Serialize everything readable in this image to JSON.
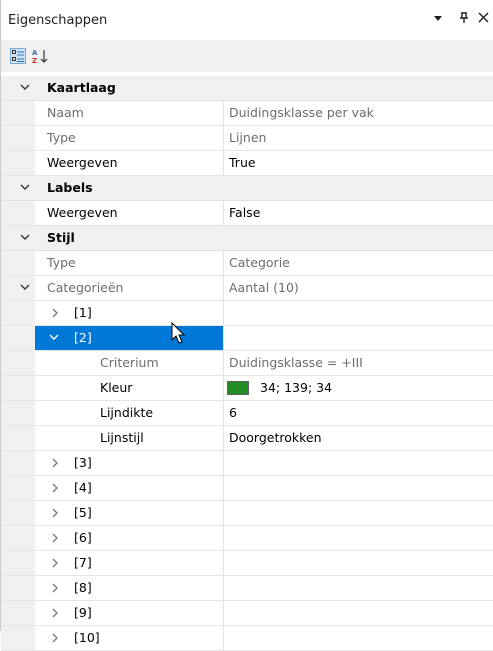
{
  "panel": {
    "title": "Eigenschappen",
    "pin_glyph": "▾",
    "dock_glyph": "ᵽ",
    "close_glyph": "✕"
  },
  "toolbar": {
    "categorized_icon": "categorized-icon",
    "alphabetical_icon": "alphabetical-sort-icon"
  },
  "sections": {
    "kaartlaag": {
      "label": "Kaartlaag",
      "naam_label": "Naam",
      "naam_value": "Duidingsklasse per vak",
      "type_label": "Type",
      "type_value": "Lijnen",
      "weergeven_label": "Weergeven",
      "weergeven_value": "True"
    },
    "labels": {
      "label": "Labels",
      "weergeven_label": "Weergeven",
      "weergeven_value": "False"
    },
    "stijl": {
      "label": "Stijl",
      "type_label": "Type",
      "type_value": "Categorie",
      "categorieen_label": "Categorieën",
      "categorieen_value": "Aantal (10)",
      "items": [
        "[1]",
        "[2]",
        "[3]",
        "[4]",
        "[5]",
        "[6]",
        "[7]",
        "[8]",
        "[9]",
        "[10]"
      ],
      "item2": {
        "criterium_label": "Criterium",
        "criterium_value": "Duidingsklasse = +III",
        "kleur_label": "Kleur",
        "kleur_value": "34; 139; 34",
        "kleur_color": "#228b22",
        "lijndikte_label": "Lijndikte",
        "lijndikte_value": "6",
        "lijnstijl_label": "Lijnstijl",
        "lijnstijl_value": "Doorgetrokken"
      }
    }
  },
  "colors": {
    "selection": "#0078d7",
    "category_bg": "#f0f0f0",
    "dim_text": "#6d6d6d"
  }
}
